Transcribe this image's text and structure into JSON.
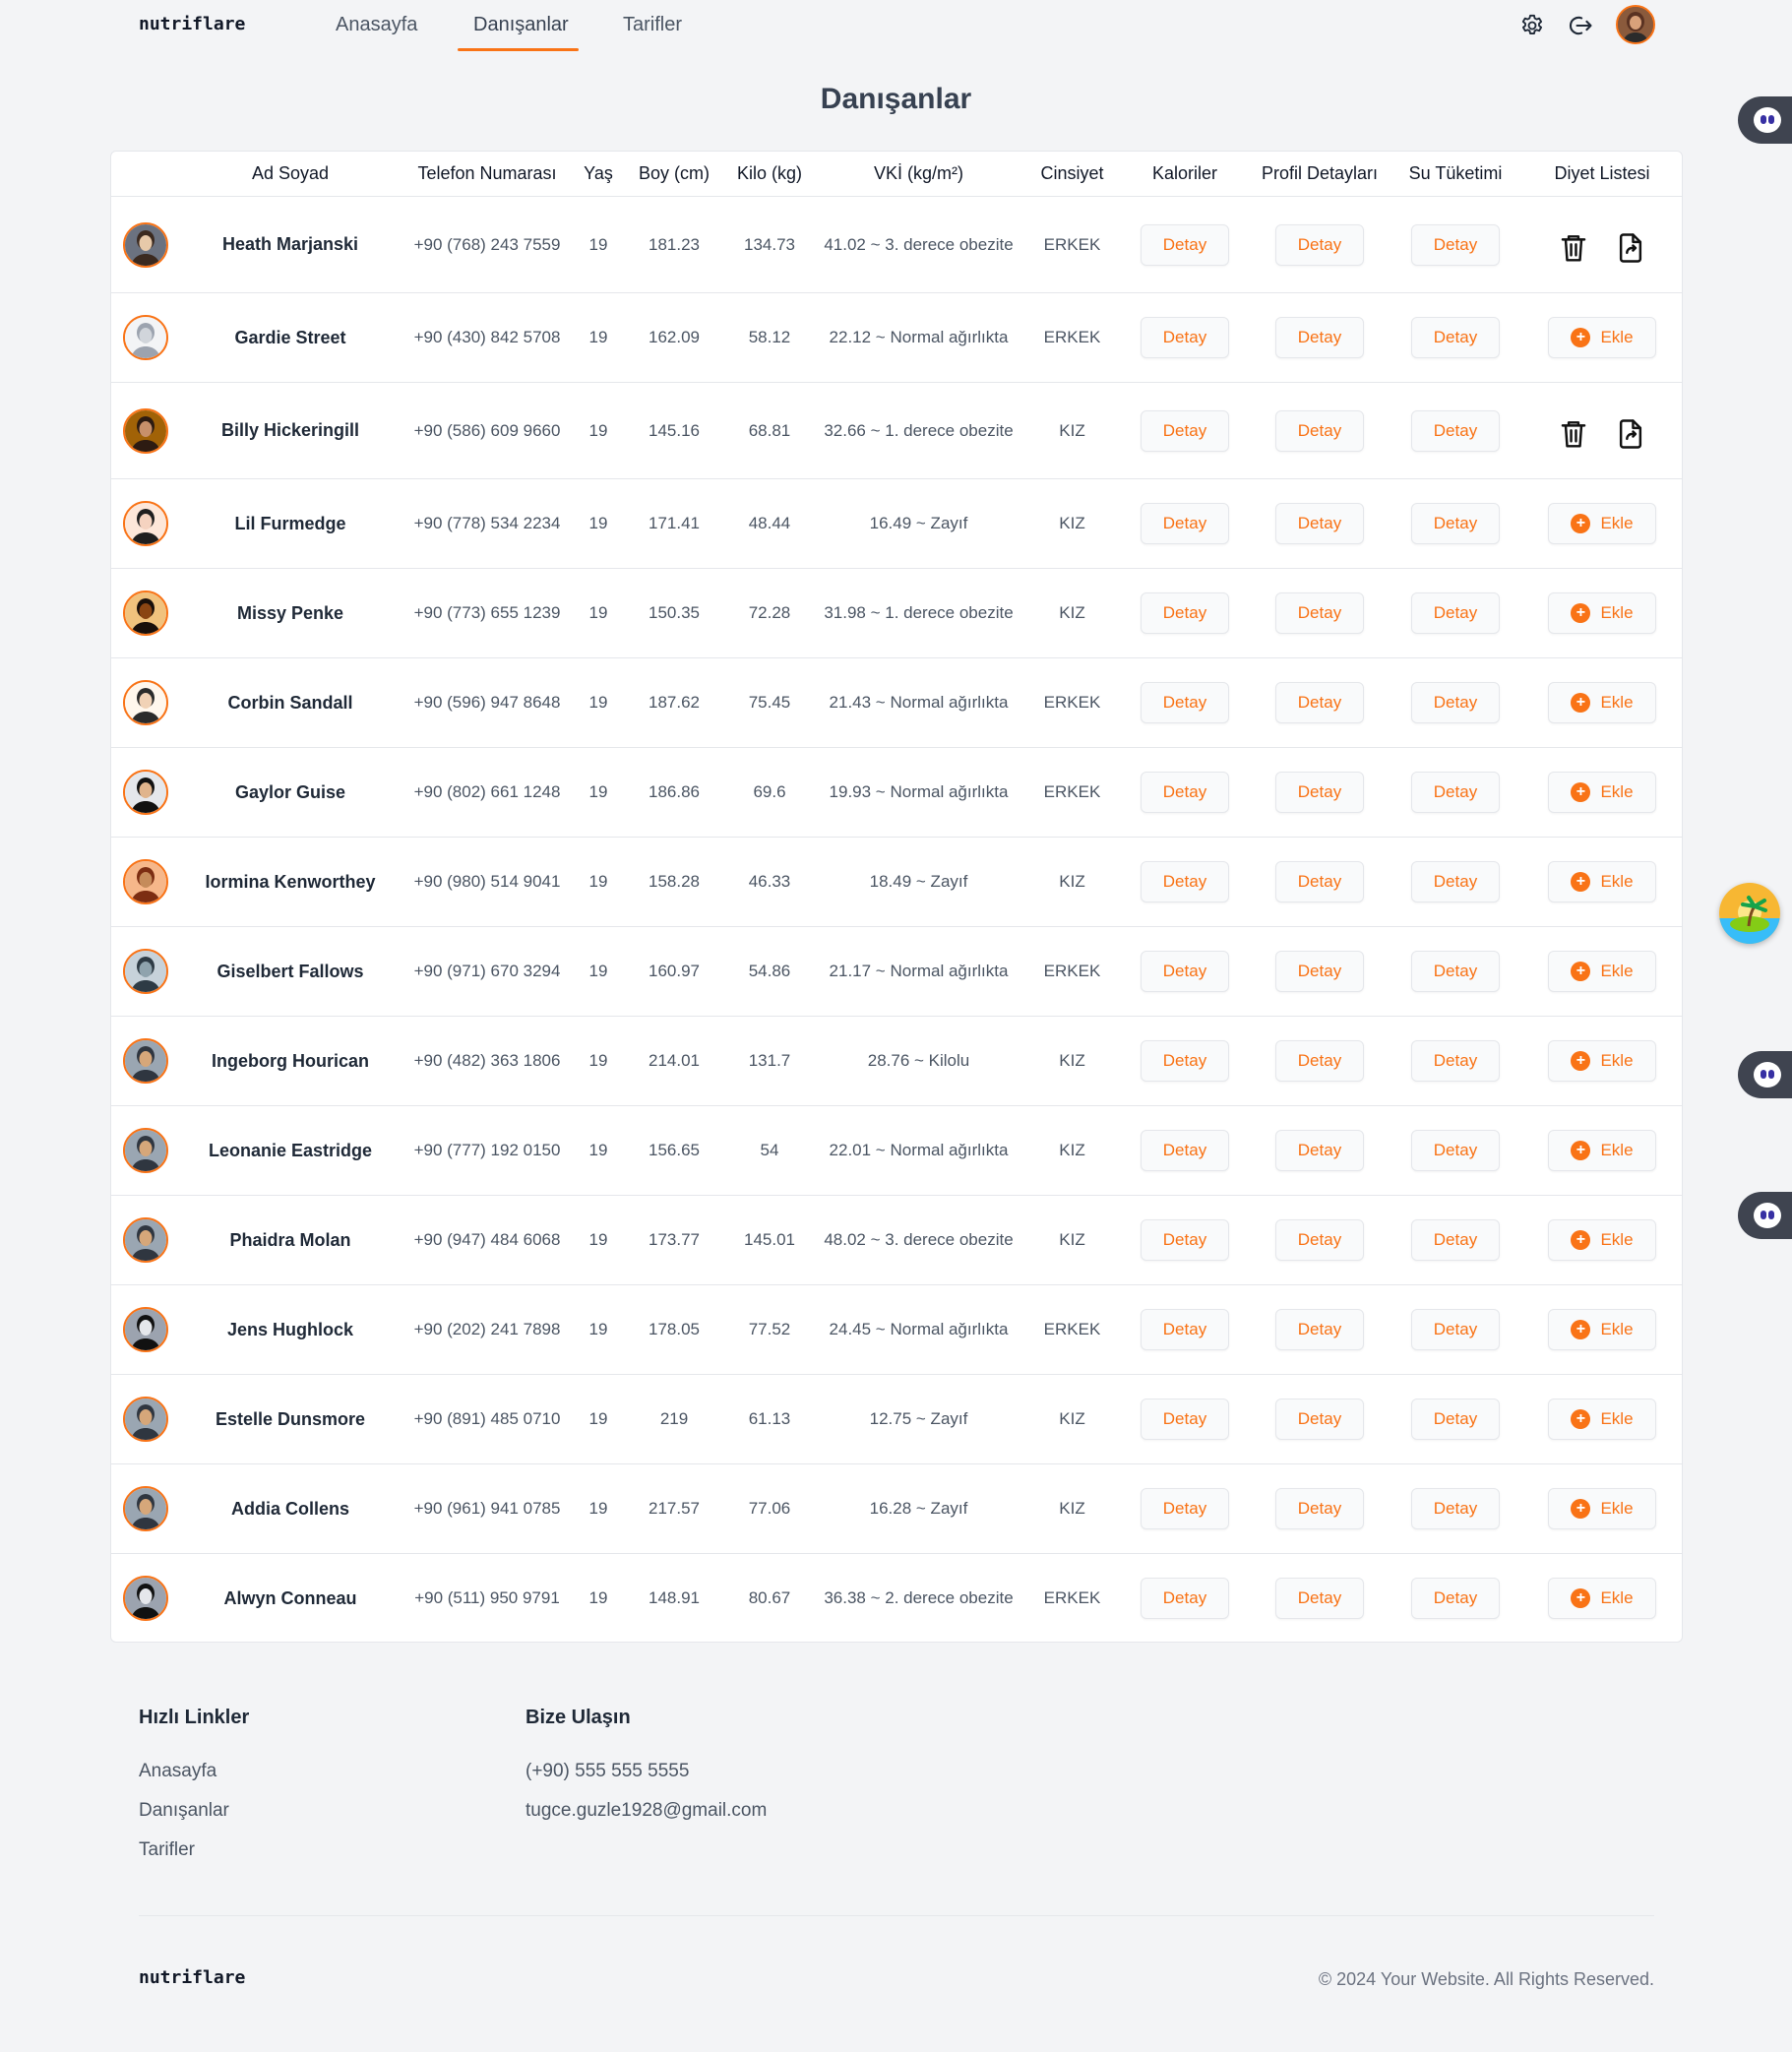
{
  "header": {
    "logo": "nutriflare",
    "nav": [
      {
        "label": "Anasayfa",
        "active": false
      },
      {
        "label": "Danışanlar",
        "active": true
      },
      {
        "label": "Tarifler",
        "active": false
      }
    ],
    "accent_color": "#f97316"
  },
  "page": {
    "title": "Danışanlar"
  },
  "table": {
    "columns": [
      "",
      "Ad Soyad",
      "Telefon Numarası",
      "Yaş",
      "Boy (cm)",
      "Kilo (kg)",
      "VKİ (kg/m²)",
      "Cinsiyet",
      "Kaloriler",
      "Profil Detayları",
      "Su Tüketimi",
      "Diyet Listesi"
    ],
    "detail_label": "Detay",
    "add_label": "Ekle",
    "rows": [
      {
        "name": "Heath Marjanski",
        "phone": "+90 (768) 243 7559",
        "age": "19",
        "height": "181.23",
        "weight": "134.73",
        "bmi": "41.02 ~ 3. derece obezite",
        "gender": "ERKEK",
        "diet": "icons"
      },
      {
        "name": "Gardie Street",
        "phone": "+90 (430) 842 5708",
        "age": "19",
        "height": "162.09",
        "weight": "58.12",
        "bmi": "22.12 ~ Normal ağırlıkta",
        "gender": "ERKEK",
        "diet": "add"
      },
      {
        "name": "Billy Hickeringill",
        "phone": "+90 (586) 609 9660",
        "age": "19",
        "height": "145.16",
        "weight": "68.81",
        "bmi": "32.66 ~ 1. derece obezite",
        "gender": "KIZ",
        "diet": "icons"
      },
      {
        "name": "Lil Furmedge",
        "phone": "+90 (778) 534 2234",
        "age": "19",
        "height": "171.41",
        "weight": "48.44",
        "bmi": "16.49 ~ Zayıf",
        "gender": "KIZ",
        "diet": "add"
      },
      {
        "name": "Missy Penke",
        "phone": "+90 (773) 655 1239",
        "age": "19",
        "height": "150.35",
        "weight": "72.28",
        "bmi": "31.98 ~ 1. derece obezite",
        "gender": "KIZ",
        "diet": "add"
      },
      {
        "name": "Corbin Sandall",
        "phone": "+90 (596) 947 8648",
        "age": "19",
        "height": "187.62",
        "weight": "75.45",
        "bmi": "21.43 ~ Normal ağırlıkta",
        "gender": "ERKEK",
        "diet": "add"
      },
      {
        "name": "Gaylor Guise",
        "phone": "+90 (802) 661 1248",
        "age": "19",
        "height": "186.86",
        "weight": "69.6",
        "bmi": "19.93 ~ Normal ağırlıkta",
        "gender": "ERKEK",
        "diet": "add"
      },
      {
        "name": "Iormina Kenworthey",
        "phone": "+90 (980) 514 9041",
        "age": "19",
        "height": "158.28",
        "weight": "46.33",
        "bmi": "18.49 ~ Zayıf",
        "gender": "KIZ",
        "diet": "add"
      },
      {
        "name": "Giselbert Fallows",
        "phone": "+90 (971) 670 3294",
        "age": "19",
        "height": "160.97",
        "weight": "54.86",
        "bmi": "21.17 ~ Normal ağırlıkta",
        "gender": "ERKEK",
        "diet": "add"
      },
      {
        "name": "Ingeborg Hourican",
        "phone": "+90 (482) 363 1806",
        "age": "19",
        "height": "214.01",
        "weight": "131.7",
        "bmi": "28.76 ~ Kilolu",
        "gender": "KIZ",
        "diet": "add"
      },
      {
        "name": "Leonanie Eastridge",
        "phone": "+90 (777) 192 0150",
        "age": "19",
        "height": "156.65",
        "weight": "54",
        "bmi": "22.01 ~ Normal ağırlıkta",
        "gender": "KIZ",
        "diet": "add"
      },
      {
        "name": "Phaidra Molan",
        "phone": "+90 (947) 484 6068",
        "age": "19",
        "height": "173.77",
        "weight": "145.01",
        "bmi": "48.02 ~ 3. derece obezite",
        "gender": "KIZ",
        "diet": "add"
      },
      {
        "name": "Jens Hughlock",
        "phone": "+90 (202) 241 7898",
        "age": "19",
        "height": "178.05",
        "weight": "77.52",
        "bmi": "24.45 ~ Normal ağırlıkta",
        "gender": "ERKEK",
        "diet": "add"
      },
      {
        "name": "Estelle Dunsmore",
        "phone": "+90 (891) 485 0710",
        "age": "19",
        "height": "219",
        "weight": "61.13",
        "bmi": "12.75 ~ Zayıf",
        "gender": "KIZ",
        "diet": "add"
      },
      {
        "name": "Addia Collens",
        "phone": "+90 (961) 941 0785",
        "age": "19",
        "height": "217.57",
        "weight": "77.06",
        "bmi": "16.28 ~ Zayıf",
        "gender": "KIZ",
        "diet": "add"
      },
      {
        "name": "Alwyn Conneau",
        "phone": "+90 (511) 950 9791",
        "age": "19",
        "height": "148.91",
        "weight": "80.67",
        "bmi": "36.38 ~ 2. derece obezite",
        "gender": "ERKEK",
        "diet": "add"
      }
    ]
  },
  "footer": {
    "quick_links_title": "Hızlı Linkler",
    "quick_links": [
      "Anasayfa",
      "Danışanlar",
      "Tarifler"
    ],
    "contact_title": "Bize Ulaşın",
    "phone": "(+90) 555 555 5555",
    "email": "tugce.guzle1928@gmail.com",
    "logo": "nutriflare",
    "copyright": "© 2024 Your Website. All Rights Reserved."
  }
}
